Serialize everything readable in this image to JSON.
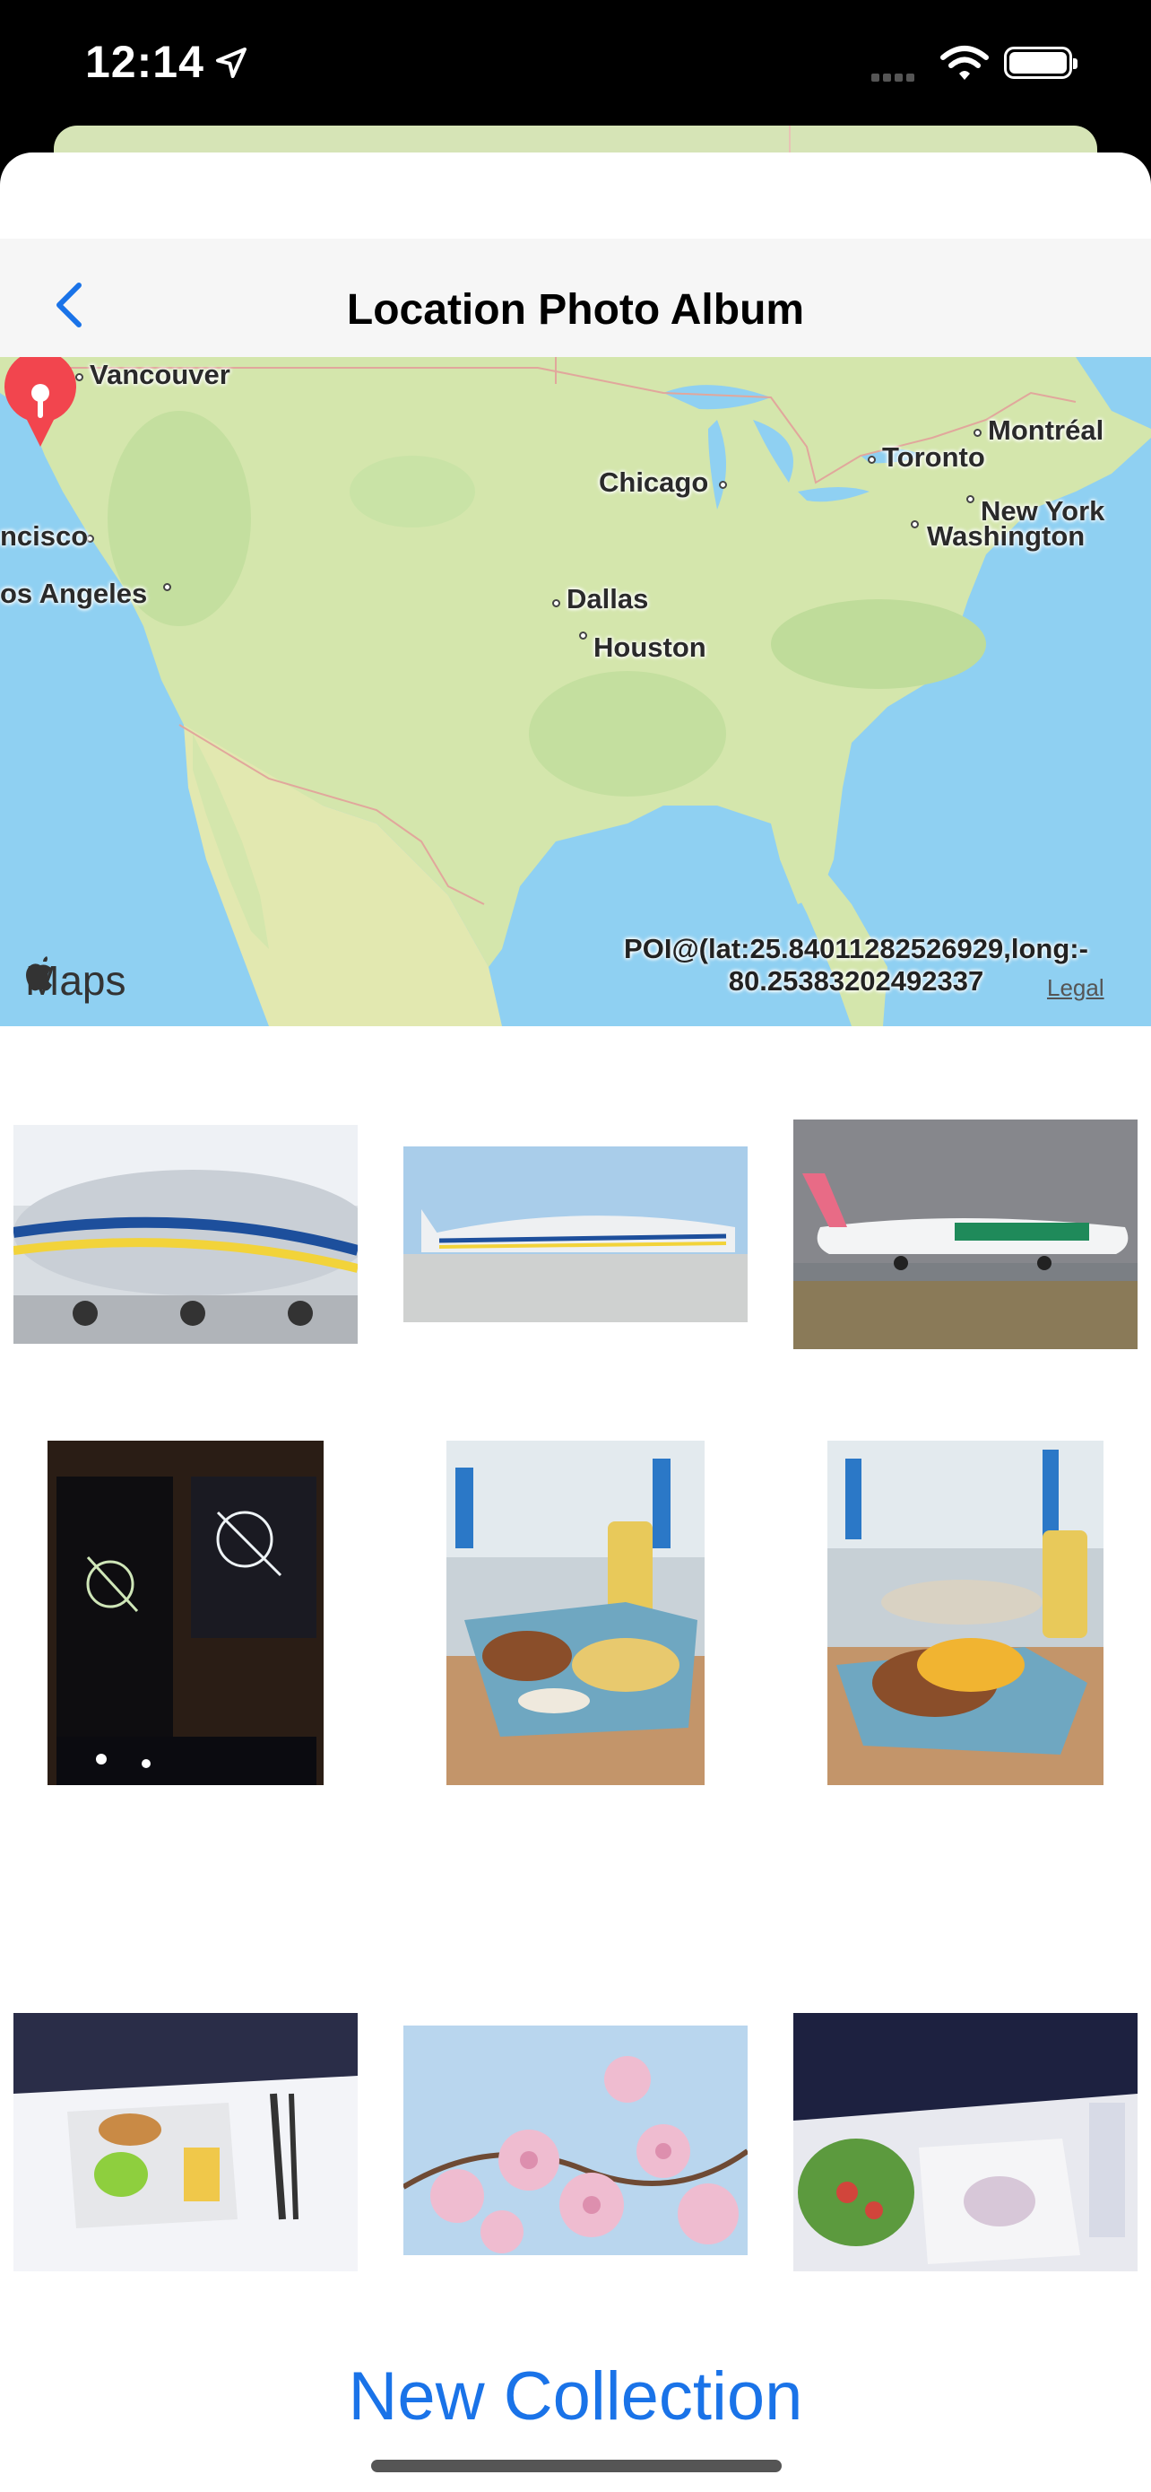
{
  "status_bar": {
    "time": "12:14",
    "location_icon": "location-arrow-icon",
    "wifi_icon": "wifi-icon",
    "battery_icon": "battery-icon"
  },
  "nav": {
    "title": "Location Photo Album",
    "back_icon": "chevron-left-icon"
  },
  "map": {
    "cities": [
      "Vancouver",
      "Montréal",
      "Toronto",
      "Chicago",
      "New York",
      "Washington",
      "ncisco",
      "os Angeles",
      "Dallas",
      "Houston"
    ],
    "attribution": "Maps",
    "poi_label_line1": "POI@(lat:25.84011282526929,long:-",
    "poi_label_line2": "80.25383202492337",
    "legal": "Legal",
    "pin_icon": "map-pin-icon"
  },
  "photos": [
    {
      "subject": "aircraft-closeup"
    },
    {
      "subject": "cargo-plane-on-tarmac"
    },
    {
      "subject": "frontier-airplane"
    },
    {
      "subject": "neon-sign-window"
    },
    {
      "subject": "burger-chips-tray"
    },
    {
      "subject": "burger-beer-tray"
    },
    {
      "subject": "inflight-meal-bread"
    },
    {
      "subject": "pink-blossoms"
    },
    {
      "subject": "inflight-meal-salad"
    }
  ],
  "actions": {
    "new_collection": "New Collection"
  },
  "colors": {
    "accent": "#1a73e8",
    "pin": "#f2454e",
    "water": "#8fd0f2",
    "land": "#d4e6ac"
  }
}
